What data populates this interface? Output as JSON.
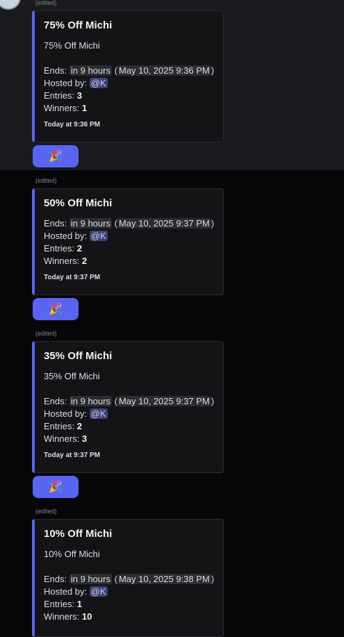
{
  "messages": [
    {
      "edited": "(edited)",
      "title": "75% Off Michi",
      "description": "75% Off Michi",
      "ends_label": "Ends:",
      "ends_relative": "in 9 hours",
      "ends_absolute": "May 10, 2025 9:36 PM",
      "hosted_label": "Hosted by:",
      "host": "@K",
      "entries_label": "Entries:",
      "entries": "3",
      "winners_label": "Winners:",
      "winners": "1",
      "footer": "Today at 9:36 PM",
      "reaction": "🎉"
    },
    {
      "edited": "(edited)",
      "title": "50% Off Michi",
      "description": "",
      "ends_label": "Ends:",
      "ends_relative": "in 9 hours",
      "ends_absolute": "May 10, 2025 9:37 PM",
      "hosted_label": "Hosted by:",
      "host": "@K",
      "entries_label": "Entries:",
      "entries": "2",
      "winners_label": "Winners:",
      "winners": "2",
      "footer": "Today at 9:37 PM",
      "reaction": "🎉"
    },
    {
      "edited": "(edited)",
      "title": "35% Off Michi",
      "description": "35% Off Michi",
      "ends_label": "Ends:",
      "ends_relative": "in 9 hours",
      "ends_absolute": "May 10, 2025 9:37 PM",
      "hosted_label": "Hosted by:",
      "host": "@K",
      "entries_label": "Entries:",
      "entries": "2",
      "winners_label": "Winners:",
      "winners": "3",
      "footer": "Today at 9:37 PM",
      "reaction": "🎉"
    },
    {
      "edited": "(edited)",
      "title": "10% Off Michi",
      "description": "10% Off Michi",
      "ends_label": "Ends:",
      "ends_relative": "in 9 hours",
      "ends_absolute": "May 10, 2025 9:38 PM",
      "hosted_label": "Hosted by:",
      "host": "@K",
      "entries_label": "Entries:",
      "entries": "1",
      "winners_label": "Winners:",
      "winners": "10"
    }
  ],
  "colors": {
    "accent": "#5865f2",
    "embed_bg": "#141417",
    "page_bg": "#070709"
  }
}
